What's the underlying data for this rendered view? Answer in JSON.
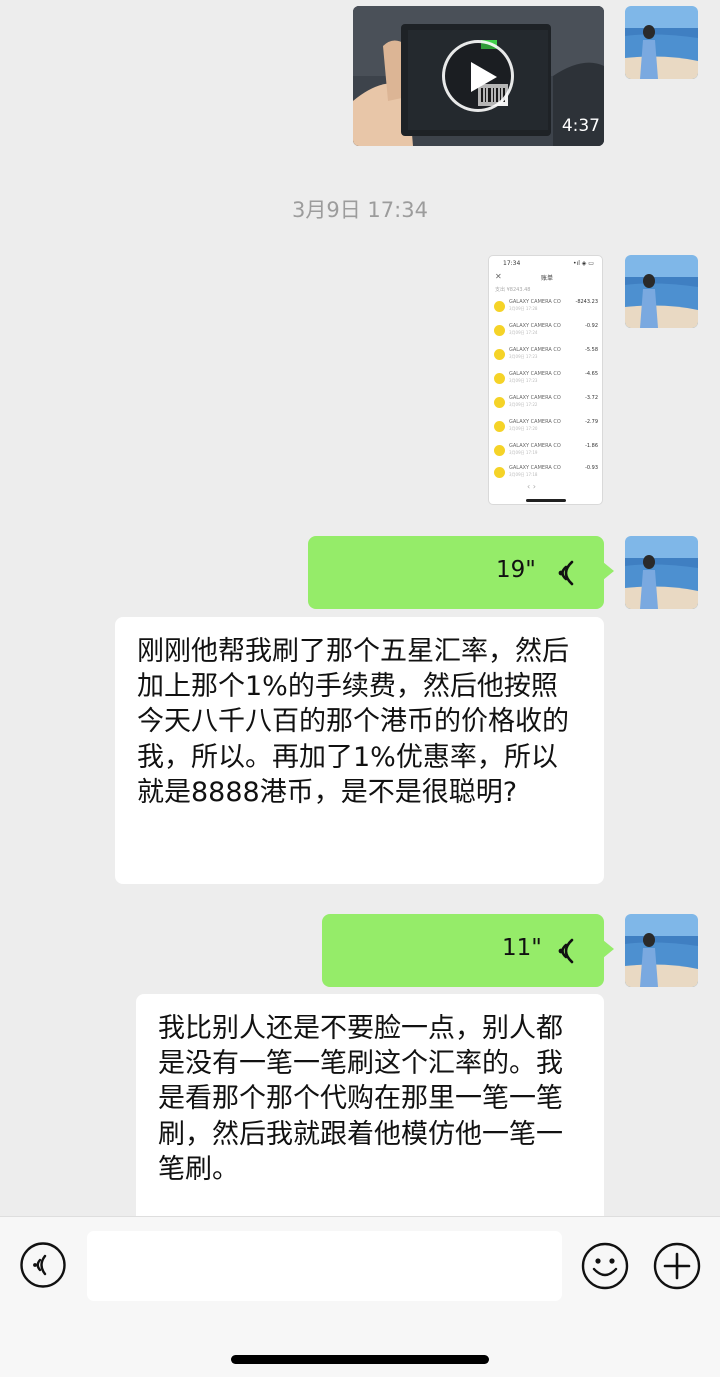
{
  "messages": {
    "video": {
      "duration": "4:37"
    },
    "timestamp": "3月9日 17:34",
    "screenshot": {
      "status_time": "17:34",
      "status_right": "•ıl ◈ ▭",
      "close_glyph": "✕",
      "title": "账单",
      "subtitle": "支出 ¥8243.48",
      "rows": [
        {
          "name": "GALAXY CAMERA CO",
          "date": "3月09日 17:28",
          "amount": "-8243.23"
        },
        {
          "name": "GALAXY CAMERA CO",
          "date": "3月09日 17:24",
          "amount": "-0.92"
        },
        {
          "name": "GALAXY CAMERA CO",
          "date": "3月09日 17:23",
          "amount": "-5.58"
        },
        {
          "name": "GALAXY CAMERA CO",
          "date": "3月09日 17:23",
          "amount": "-4.65"
        },
        {
          "name": "GALAXY CAMERA CO",
          "date": "3月09日 17:22",
          "amount": "-3.72"
        },
        {
          "name": "GALAXY CAMERA CO",
          "date": "3月09日 17:20",
          "amount": "-2.79"
        },
        {
          "name": "GALAXY CAMERA CO",
          "date": "3月09日 17:19",
          "amount": "-1.86"
        },
        {
          "name": "GALAXY CAMERA CO",
          "date": "3月09日 17:18",
          "amount": "-0.93"
        }
      ],
      "nav": "‹      ›"
    },
    "voice1": {
      "duration": "19\""
    },
    "text1": "刚刚他帮我刷了那个五星汇率，然后加上那个1%的手续费，然后他按照今天八千八百的那个港币的价格收的我，所以。再加了1%优惠率，所以就是8888港币，是不是很聪明?",
    "voice2": {
      "duration": "11\""
    },
    "text2": "我比别人还是不要脸一点，别人都是没有一笔一笔刷这个汇率的。我是看那个那个代购在那里一笔一笔刷，然后我就跟着他模仿他一笔一笔刷。"
  },
  "input_bar": {
    "input_value": "",
    "icons": {
      "voice": "voice-mode-icon",
      "emoji": "emoji-icon",
      "plus": "plus-icon"
    }
  },
  "colors": {
    "outgoing_bubble": "#95ec69",
    "incoming_bubble": "#ffffff",
    "background": "#ededed",
    "timestamp": "#9c9c9c"
  }
}
